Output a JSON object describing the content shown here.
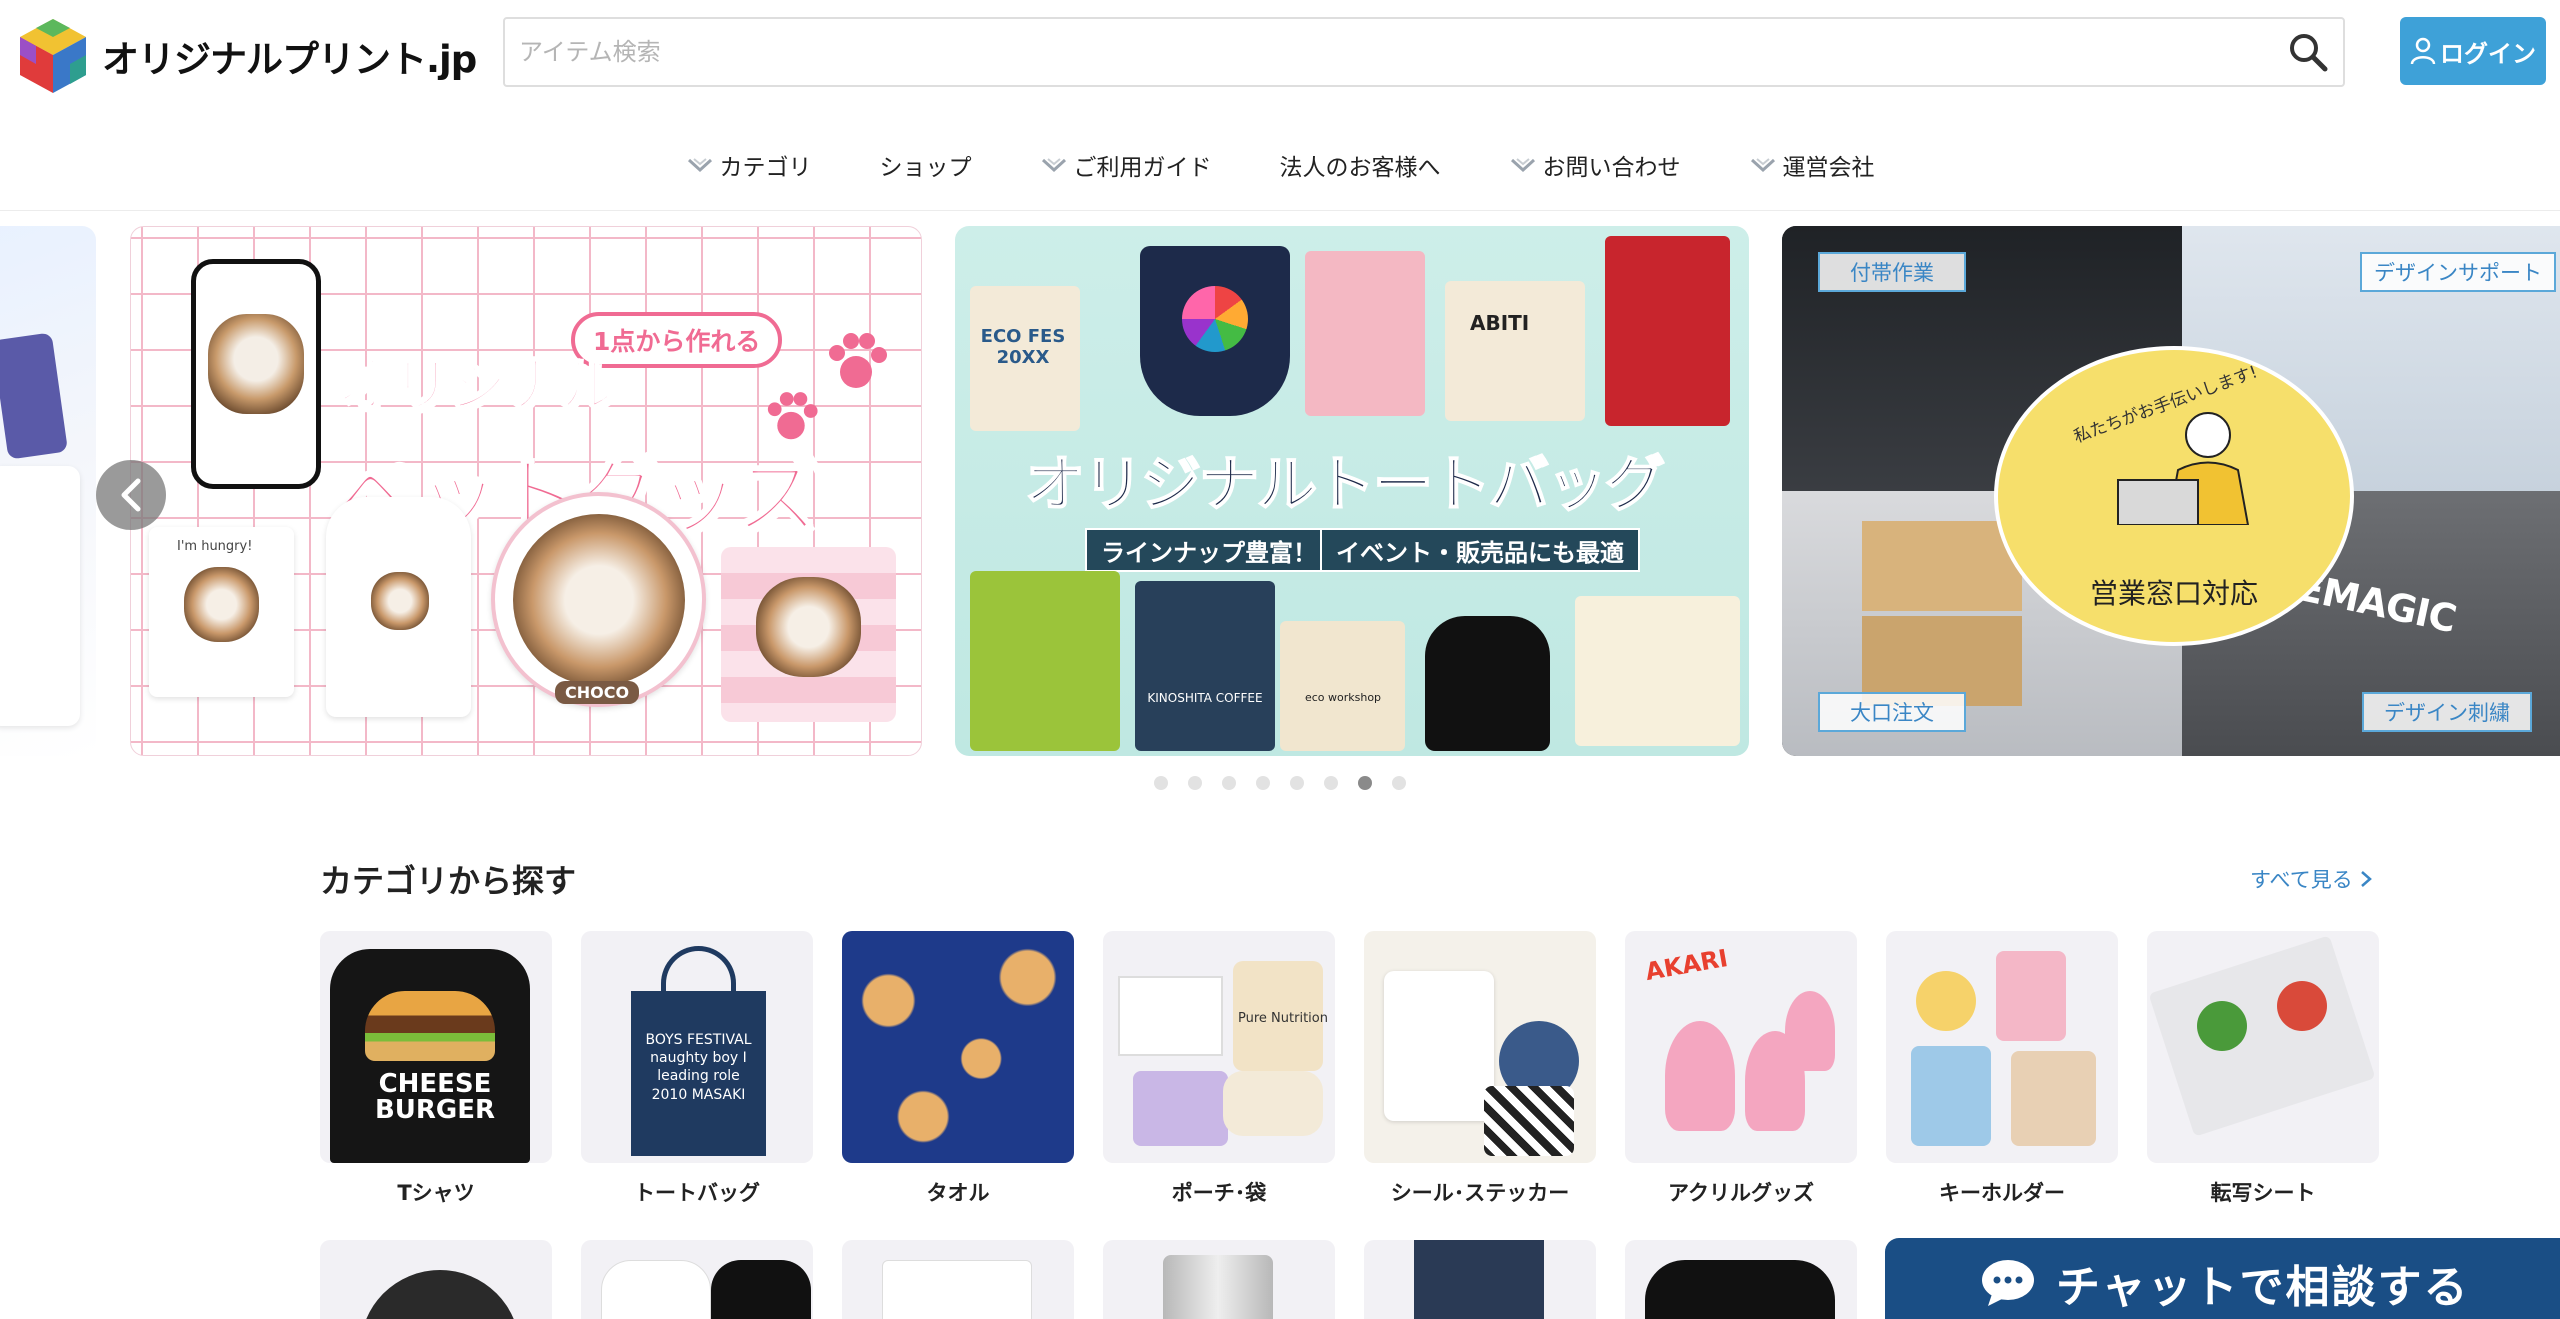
{
  "header": {
    "logo_text": "オリジナルプリント.jp",
    "search_placeholder": "アイテム検索",
    "login_label": "ログイン"
  },
  "nav": [
    {
      "label": "カテゴリ",
      "has_dropdown": true
    },
    {
      "label": "ショップ",
      "has_dropdown": false
    },
    {
      "label": "ご利用ガイド",
      "has_dropdown": true
    },
    {
      "label": "法人のお客様へ",
      "has_dropdown": false
    },
    {
      "label": "お問い合わせ",
      "has_dropdown": true
    },
    {
      "label": "運営会社",
      "has_dropdown": true
    }
  ],
  "carousel": {
    "pet": {
      "title_line1": "オリジナル",
      "title_line2": "ペットグッズ",
      "pill": "1点から作れる",
      "sticker_text": "I'm hungry!",
      "name_tag": "CHOCO"
    },
    "tote": {
      "title": "オリジナルトートバッグ",
      "tag1": "ラインナップ豊富！",
      "tag2": "イベント・販売品にも最適",
      "bag_eco": "ECO FES 20XX",
      "bag_abiti": "ABITI",
      "bag_kinoshita": "KINOSHITA COFFEE",
      "bag_eco_workshop": "eco workshop"
    },
    "business": {
      "label_top_left": "付帯作業",
      "label_top_right": "デザインサポート",
      "label_bottom_left": "大口注文",
      "label_bottom_right": "デザイン刺繍",
      "circle_tagline": "私たちがお手伝いします!",
      "circle_main": "営業窓口対応",
      "brand": "MAGEMAGIC"
    },
    "dot_count": 8,
    "active_dot": 6
  },
  "categories": {
    "title": "カテゴリから探す",
    "see_all": "すべて見る",
    "items": [
      {
        "label": "Tシャツ",
        "image_text": "CHEESE BURGER"
      },
      {
        "label": "トートバッグ",
        "image_text": "BOYS FESTIVAL naughty boy I leading role 2010 MASAKI"
      },
      {
        "label": "タオル",
        "image_text": ""
      },
      {
        "label": "ポーチ･袋",
        "image_text": "Pure Nutrition"
      },
      {
        "label": "シール･ステッカー",
        "image_text": ""
      },
      {
        "label": "アクリルグッズ",
        "image_text": "AKARI"
      },
      {
        "label": "キーホルダー",
        "image_text": ""
      },
      {
        "label": "転写シート",
        "image_text": ""
      }
    ]
  },
  "chat": {
    "label": "チャットで相談する"
  },
  "colors": {
    "accent_blue": "#3ea1d8",
    "link_blue": "#3a86c5",
    "chat_navy": "#1a4e85",
    "pet_pink": "#f06b93"
  }
}
